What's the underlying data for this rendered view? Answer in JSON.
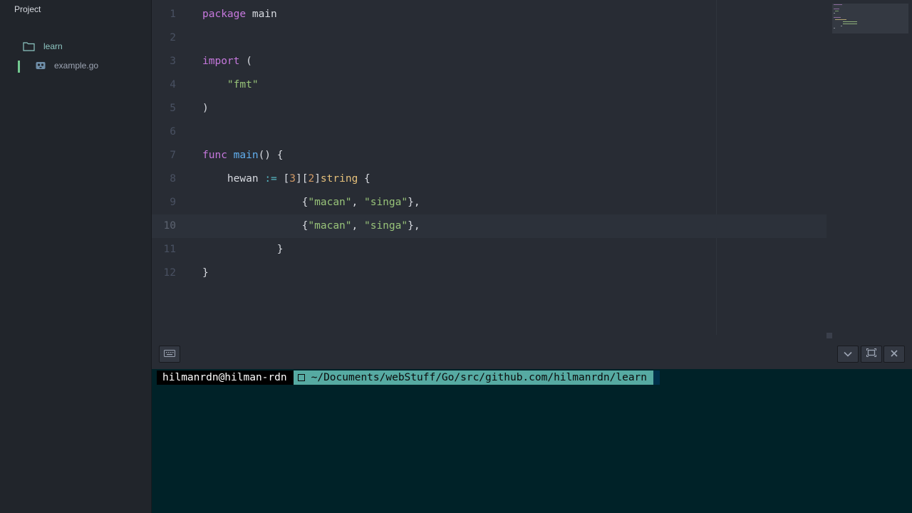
{
  "sidebar": {
    "title": "Project",
    "folder": {
      "label": "learn",
      "icon": "folder-icon"
    },
    "file": {
      "label": "example.go",
      "icon": "file-icon"
    }
  },
  "editor": {
    "lines": [
      {
        "num": "1",
        "tokens": [
          [
            "kw",
            "package"
          ],
          [
            "plain",
            " main"
          ]
        ]
      },
      {
        "num": "2",
        "tokens": []
      },
      {
        "num": "3",
        "tokens": [
          [
            "kw",
            "import"
          ],
          [
            "plain",
            " ("
          ]
        ]
      },
      {
        "num": "4",
        "tokens": [
          [
            "plain",
            "    "
          ],
          [
            "str",
            "\"fmt\""
          ]
        ]
      },
      {
        "num": "5",
        "tokens": [
          [
            "plain",
            ")"
          ]
        ]
      },
      {
        "num": "6",
        "tokens": []
      },
      {
        "num": "7",
        "tokens": [
          [
            "kw",
            "func"
          ],
          [
            "plain",
            " "
          ],
          [
            "fn",
            "main"
          ],
          [
            "plain",
            "() {"
          ]
        ]
      },
      {
        "num": "8",
        "tokens": [
          [
            "plain",
            "    hewan "
          ],
          [
            "op",
            ":="
          ],
          [
            "plain",
            " ["
          ],
          [
            "num",
            "3"
          ],
          [
            "plain",
            "]["
          ],
          [
            "num",
            "2"
          ],
          [
            "plain",
            "]"
          ],
          [
            "typ",
            "string"
          ],
          [
            "plain",
            " {"
          ]
        ]
      },
      {
        "num": "9",
        "tokens": [
          [
            "plain",
            "                {"
          ],
          [
            "str",
            "\"macan\""
          ],
          [
            "plain",
            ", "
          ],
          [
            "str",
            "\"singa\""
          ],
          [
            "plain",
            "},"
          ]
        ]
      },
      {
        "num": "10",
        "tokens": [
          [
            "plain",
            "                {"
          ],
          [
            "str",
            "\"macan\""
          ],
          [
            "plain",
            ", "
          ],
          [
            "str",
            "\"singa\""
          ],
          [
            "plain",
            "},"
          ]
        ],
        "active": true
      },
      {
        "num": "11",
        "tokens": [
          [
            "plain",
            "            }"
          ]
        ]
      },
      {
        "num": "12",
        "tokens": [
          [
            "plain",
            "}"
          ]
        ]
      }
    ]
  },
  "terminal": {
    "user": "hilmanrdn@hilman-rdn",
    "path": "~/Documents/webStuff/Go/src/github.com/hilmanrdn/learn",
    "buttons": [
      "keyboard-icon",
      "chevron-down-icon",
      "maximize-icon",
      "close-icon"
    ]
  }
}
